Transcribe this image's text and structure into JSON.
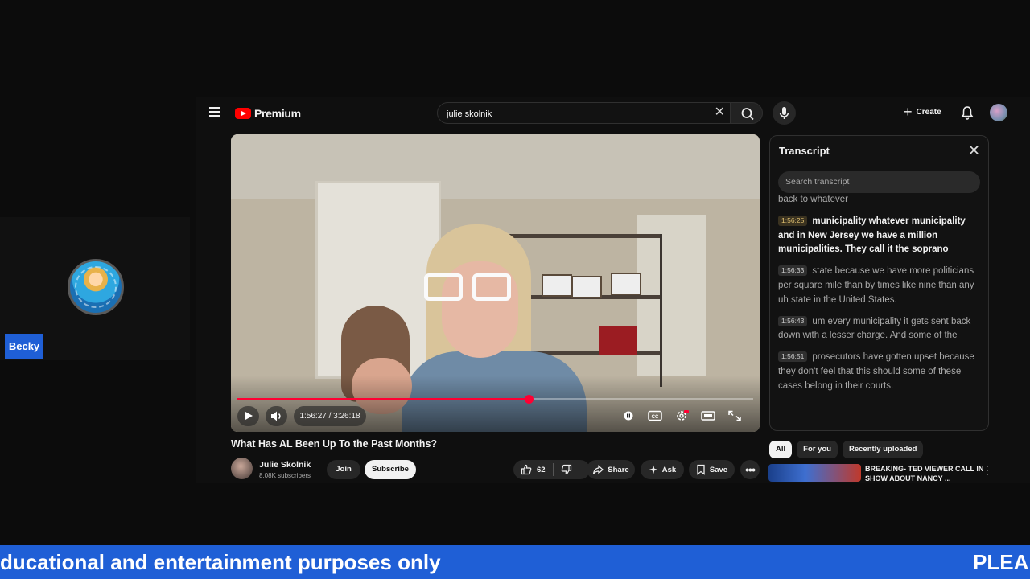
{
  "guest": {
    "name": "Becky",
    "avatar_icon": "guest-avatar-logo"
  },
  "youtube": {
    "logo_text": "Premium",
    "search": {
      "value": "julie skolnik"
    },
    "create_label": "Create",
    "video": {
      "current_time": "1:56:27",
      "duration": "3:26:18",
      "time_display": "1:56:27 / 3:26:18",
      "progress_fraction": 0.565,
      "title": "What Has AL Been Up To the Past Months?"
    },
    "channel": {
      "name": "Julie Skolnik",
      "subscribers": "8.08K subscribers"
    },
    "actions": {
      "join": "Join",
      "subscribe": "Subscribe",
      "likes": "62",
      "share": "Share",
      "ask": "Ask",
      "save": "Save"
    },
    "transcript": {
      "title": "Transcript",
      "search_placeholder": "Search transcript",
      "partial_first_line": "back to whatever",
      "segments": [
        {
          "time": "1:56:25",
          "text": "municipality whatever municipality and in New Jersey we have a million municipalities. They call it the soprano",
          "active": true
        },
        {
          "time": "1:56:33",
          "text": "state because we have more politicians per square mile than by times like nine than any uh state in the United States.",
          "active": false
        },
        {
          "time": "1:56:43",
          "text": "um every municipality it gets sent back down with a lesser charge. And some of the",
          "active": false
        },
        {
          "time": "1:56:51",
          "text": "prosecutors have gotten upset because they don't feel that this should some of these cases belong in their courts.",
          "active": false
        }
      ]
    },
    "chips": [
      "All",
      "For you",
      "Recently uploaded"
    ],
    "recommendation": {
      "title": "BREAKING- TED VIEWER CALL IN SHOW ABOUT NANCY ..."
    }
  },
  "ticker": {
    "left_text": "ducational and entertainment purposes only",
    "right_text": "PLEA"
  },
  "colors": {
    "accent_red": "#ff0033",
    "ticker_blue": "#1f5fd6",
    "bg": "#0f0f0f"
  }
}
